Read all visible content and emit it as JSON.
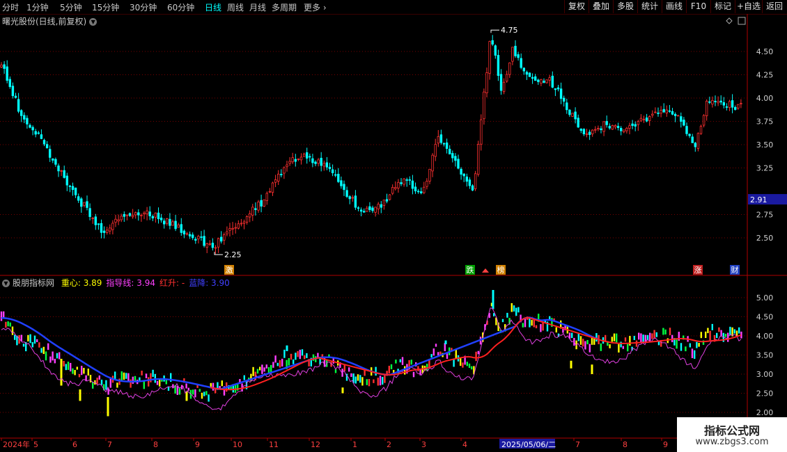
{
  "toolbar": {
    "periods": [
      "分时",
      "1分钟",
      "5分钟",
      "15分钟",
      "30分钟",
      "60分钟",
      "日线",
      "周线",
      "月线",
      "多周期",
      "更多"
    ],
    "active_period": "日线",
    "right_buttons": [
      "复权",
      "叠加",
      "多股",
      "统计",
      "画线",
      "F10",
      "标记",
      "+自选",
      "返回"
    ]
  },
  "main_chart": {
    "title": "曙光股份(日线,前复权)",
    "y_ticks": [
      "4.50",
      "4.25",
      "4.00",
      "3.75",
      "3.50",
      "3.25",
      "2.75",
      "2.50"
    ],
    "current_price": "2.91",
    "high_label": "4.75",
    "low_label": "2.25",
    "event_markers": [
      "激",
      "跌",
      "榜",
      "涨",
      "财"
    ]
  },
  "indicator": {
    "name": "股朋指标网",
    "items": [
      {
        "label": "重心:",
        "value": "3.89",
        "color": "#ffff00"
      },
      {
        "label": "指导线:",
        "value": "3.94",
        "color": "#ff40ff"
      },
      {
        "label": "红升:",
        "value": "-",
        "color": "#ff3030"
      },
      {
        "label": "蓝降:",
        "value": "3.90",
        "color": "#4040ff"
      }
    ],
    "y_ticks": [
      "5.00",
      "4.50",
      "4.00",
      "3.50",
      "3.00",
      "2.50",
      "2.00"
    ]
  },
  "time_axis": {
    "labels": [
      "2024年",
      "5",
      "6",
      "7",
      "8",
      "9",
      "10",
      "11",
      "12",
      "1",
      "2",
      "3",
      "4",
      "7",
      "8",
      "9"
    ],
    "cursor_date": "2025/05/06/二"
  },
  "watermark": {
    "line1": "指标公式网",
    "line2": "www.zbgs3.com"
  },
  "colors": {
    "up": "#ff3030",
    "down": "#00ffff",
    "grid": "#7a0000",
    "accent": "#00ffff"
  }
}
